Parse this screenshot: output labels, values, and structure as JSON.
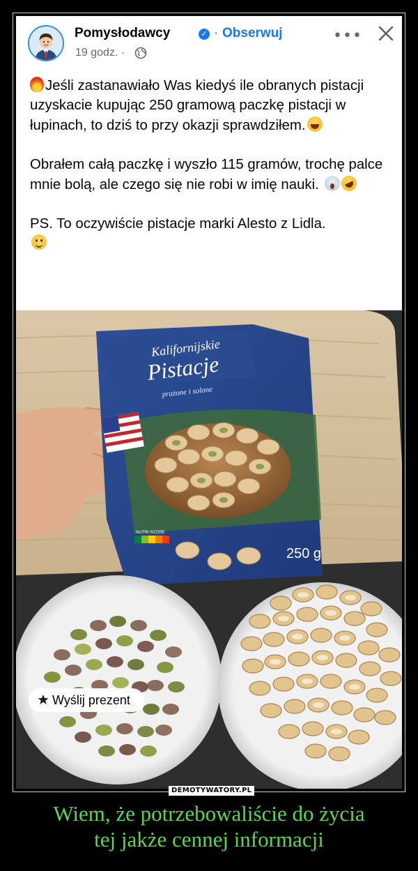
{
  "post": {
    "page_name": "Pomysłodawcy",
    "separator": "·",
    "follow_label": "Obserwuj",
    "time": "19 godz. ·",
    "more_label": "•••",
    "paragraph1": "Jeśli zastanawiało Was kiedyś ile obranych pistacji uzyskacie kupując 250 gramową paczkę pistacji w łupinach, to dziś to przy okazji sprawdziłem.",
    "paragraph2": "Obrałem całą paczkę i wyszło 115 gramów, trochę palce mnie bolą, ale czego się nie robi w imię nauki.",
    "paragraph3": "PS. To oczywiście pistacje marki Alesto z Lidla.",
    "gift_label": "Wyślij prezent"
  },
  "package": {
    "brand_line1": "Kalifornijskie",
    "brand_line2": "Pistacje",
    "subtitle": "prażone i solone",
    "weight": "250 g",
    "nutri_label": "NUTRI-SCORE"
  },
  "icons": {
    "avatar": "avatar-man-icon",
    "verified": "verified-check-icon",
    "globe": "globe-icon",
    "more": "more-options-icon",
    "close": "close-icon",
    "gift": "gift-icon"
  },
  "watermark": "DEMOTYWATORY.PL",
  "caption": {
    "line1": "Wiem, że potrzebowaliście do życia",
    "line2": "tej jakże cennej informacji"
  },
  "colors": {
    "link": "#1877f2",
    "caption": "#58d84d",
    "package": "#27458e"
  }
}
